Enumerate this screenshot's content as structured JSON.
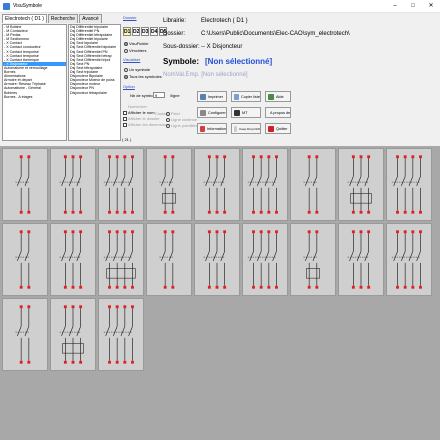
{
  "window": {
    "title": "VisuSymbole"
  },
  "tabs": [
    "Electrotech ( D1 )",
    "Recherche",
    "Avancé"
  ],
  "list1": [
    "- M Bobine",
    "- M Contacteur",
    "- M Pedas",
    "- M Sectionneur",
    "- X Contact",
    "- X Contact conducteur",
    "- X Contact temporisé",
    "- X Contact temporisé",
    "- X Contact thermique",
    "- X Disjoncteur",
    "Automaisme et verrouillage",
    "Bornes",
    "Alimentations",
    "Armoire et départ",
    "Armoire: Réseau Triphasé",
    "Automatisme - Général",
    "Bobines",
    "Bornes - A étages"
  ],
  "list1_selected": 9,
  "list2": [
    "Dsj Différentiel tripolaire",
    "Dsj Différentiel PN",
    "Dsj Différentiel tétrapolaire",
    "Dsj Différentiel bipolaire",
    "Dsj Sect bipolaire",
    "Dsj Sect Différentiel bipolaire",
    "Dsj Sect Différentiel PN",
    "Dsj Sect Différentiel tétrap",
    "Dsj Sect Différentiel tripol",
    "Dsj Sect PN",
    "Dsj Sect tétrapolaire",
    "Dsj Sect tripolaire",
    "Disjoncteur Bipolaire",
    "Disjoncteur Moteur de puiss",
    "Disjoncteur moteur",
    "Disjoncteur PN",
    "Disjoncteur tétrapolaire"
  ],
  "dossier_label": "Dossier",
  "dir_buttons": [
    "D1",
    "D2",
    "D3",
    "D4",
    "D5"
  ],
  "dir_active": 0,
  "vue_options": [
    "VisuFichier",
    "Vimchiers"
  ],
  "visualiser_label": "Visualiser",
  "visu_options": [
    "Un symbole",
    "Tous les symboles"
  ],
  "option_label": "Option",
  "info": {
    "librairie_label": "Librairie:",
    "librairie": "Electrotech ( D1 )",
    "dossier_label": "Dossier:",
    "dossier": "C:\\Users\\Public\\Documents\\Elec-CAO\\sym_electrotech\\",
    "sous_label": "Sous-dossier:",
    "sous": "-- X Disjoncteur"
  },
  "symbole": {
    "label": "Symbole:",
    "value": "[Non sélectionné]"
  },
  "nomval": "NomVal.Emp. [Non sélectionné]",
  "nb_symbole": {
    "label": "Nb de symbole :",
    "value": "9",
    "ligne": "/ligne"
  },
  "checks": [
    "Numéroter",
    "Afficher le nom",
    "Afficher le dossier",
    "Afficher les dimensions"
  ],
  "couleur": "Couleur",
  "pied": [
    "Pixel",
    "Ligne continue",
    "Ligne pointillée"
  ],
  "buttons": {
    "imprimer": "Imprimer",
    "copier": "Copier liste",
    "aide": "Aide",
    "configurer": "Configurer",
    "mt": "MT",
    "propos": "A propos de",
    "information": "Information",
    "keep": "Keep Drop Drift",
    "quitter": "Quitter"
  },
  "count": "( 21 )",
  "colors": {
    "accent": "#3399ff",
    "symbol_blue": "#1f4ed8",
    "terminal_red": "#e02020"
  }
}
